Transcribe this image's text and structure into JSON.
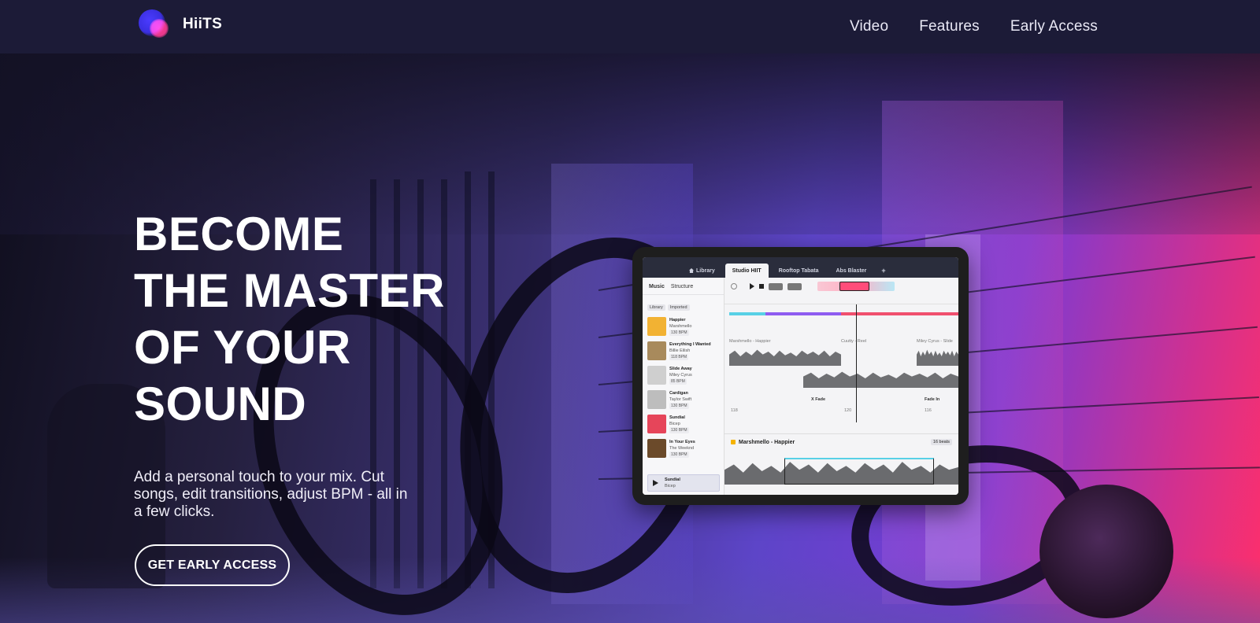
{
  "brand": {
    "name": "HiiTS"
  },
  "nav": {
    "links": [
      "Video",
      "Features",
      "Early Access"
    ]
  },
  "hero": {
    "headline_lines": [
      "BECOME",
      "THE MASTER",
      "OF YOUR",
      "SOUND"
    ],
    "subtext": "Add a personal touch to your mix. Cut songs, edit transitions, adjust BPM - all in a few clicks.",
    "cta_label": "GET EARLY ACCESS"
  },
  "app_preview": {
    "tabs": [
      "Library",
      "Studio HIIT",
      "Rooftop Tabata",
      "Abs Blaster",
      "+"
    ],
    "library": {
      "header": [
        "Music",
        "Structure"
      ],
      "filters": [
        "Library",
        "Imported"
      ],
      "songs": [
        {
          "title": "Happier",
          "artist": "Marshmello",
          "bpm": "130 BPM",
          "color": "#f2b233"
        },
        {
          "title": "Everything I Wanted",
          "artist": "Billie Eilish",
          "bpm": "118 BPM",
          "color": "#a88a5c"
        },
        {
          "title": "Slide Away",
          "artist": "Miley Cyrus",
          "bpm": "85 BPM",
          "color": "#cfcfcf"
        },
        {
          "title": "Cardigan",
          "artist": "Taylor Swift",
          "bpm": "130 BPM",
          "color": "#bdbdbd"
        },
        {
          "title": "Sundial",
          "artist": "Bicep",
          "bpm": "130 BPM",
          "color": "#e6455a"
        },
        {
          "title": "In Your Eyes",
          "artist": "The Weeknd",
          "bpm": "130 BPM",
          "color": "#6b4a2a"
        }
      ],
      "now_playing": {
        "title": "Sundial",
        "artist": "Bicep"
      }
    },
    "studio": {
      "tracks": [
        "Marshmello - Happier",
        "Cuutty - Reel",
        "Miley Cyrus - Slide"
      ],
      "bottom_track": "Marshmello - Happier",
      "transitions": [
        "X Fade",
        "Fade In"
      ],
      "bpm_values": [
        "118",
        "120",
        "116"
      ],
      "beats_label": "16 beats"
    }
  },
  "colors": {
    "nav_bg": "#1c1b37",
    "accent_pink": "#ff2f6a",
    "accent_purple": "#5d45c8"
  }
}
